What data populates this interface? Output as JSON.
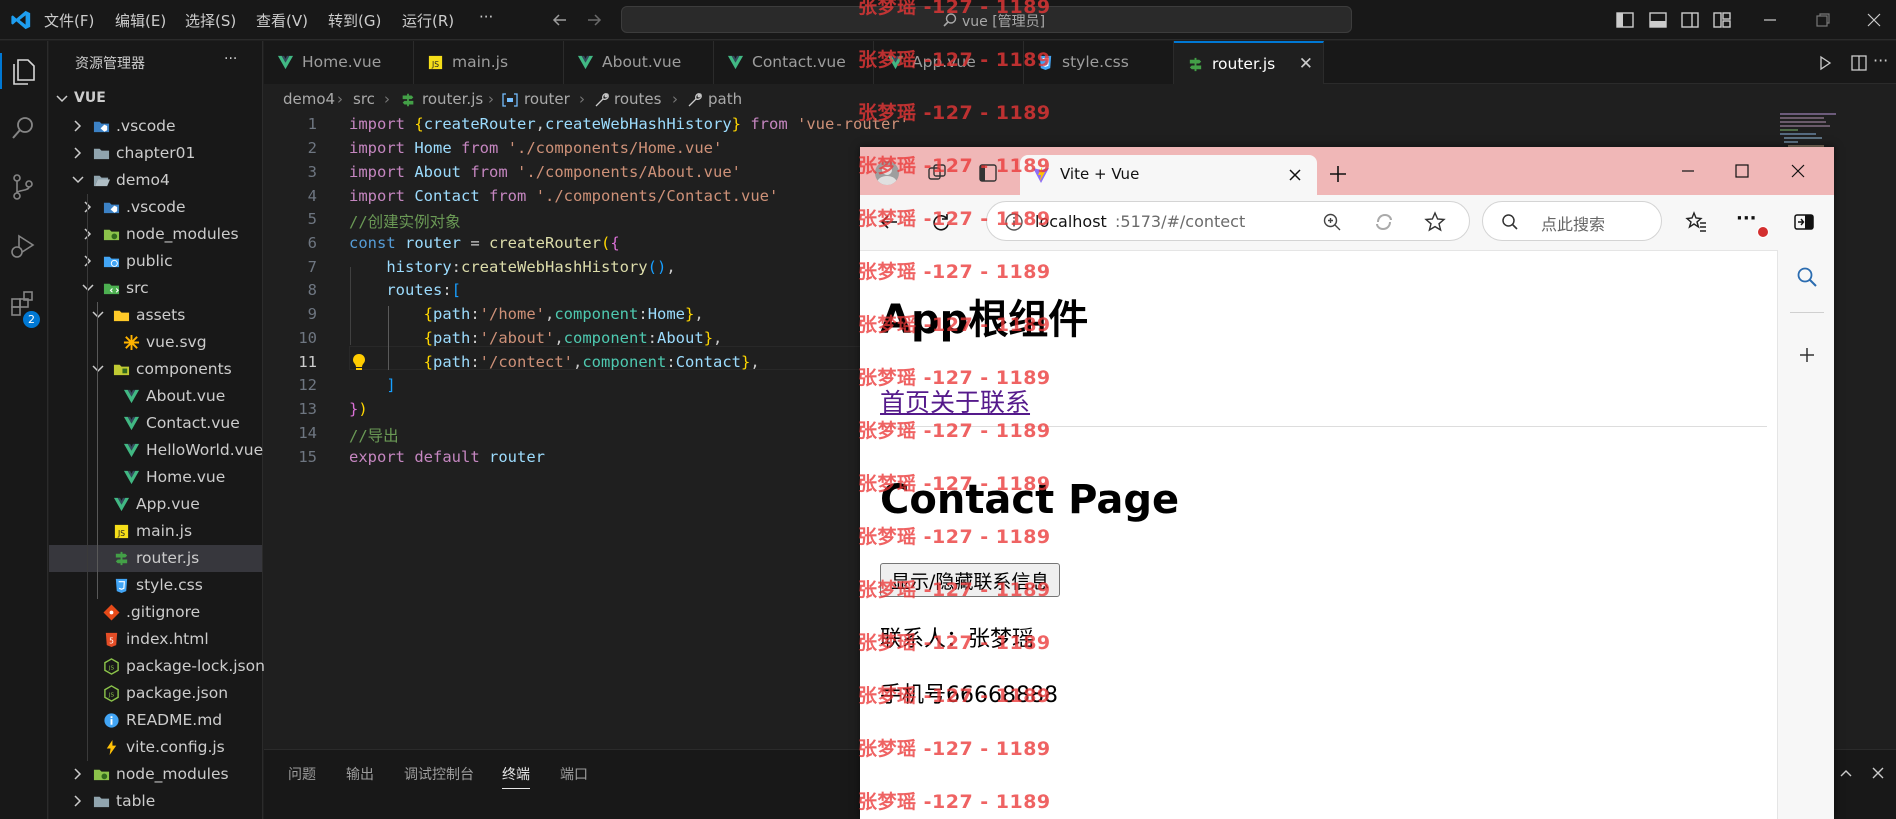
{
  "titlebar": {
    "menus": [
      "文件(F)",
      "编辑(E)",
      "选择(S)",
      "查看(V)",
      "转到(G)",
      "运行(R)",
      "···"
    ],
    "search": "vue [管理员]"
  },
  "activitybar": {
    "badge": "2"
  },
  "sidebar": {
    "title": "资源管理器",
    "more": "···",
    "root": "VUE",
    "items": [
      ".vscode",
      "chapter01",
      "demo4",
      ".vscode",
      "node_modules",
      "public",
      "src",
      "assets",
      "vue.svg",
      "components",
      "About.vue",
      "Contact.vue",
      "HelloWorld.vue",
      "Home.vue",
      "App.vue",
      "main.js",
      "router.js",
      "style.css",
      ".gitignore",
      "index.html",
      "package-lock.json",
      "package.json",
      "README.md",
      "vite.config.js",
      "node_modules",
      "table"
    ]
  },
  "tabs": [
    "Home.vue",
    "main.js",
    "About.vue",
    "Contact.vue",
    "App.vue",
    "style.css",
    "router.js"
  ],
  "breadcrumb": [
    "demo4",
    "src",
    "router.js",
    "router",
    "routes",
    "path"
  ],
  "editor": {
    "line_numbers": [
      "1",
      "2",
      "3",
      "4",
      "5",
      "6",
      "7",
      "8",
      "9",
      "10",
      "11",
      "12",
      "13",
      "14",
      "15"
    ],
    "current_line": "11"
  },
  "panel": {
    "tabs": [
      "问题",
      "输出",
      "调试控制台",
      "终端",
      "端口"
    ]
  },
  "browser": {
    "tab_title": "Vite + Vue",
    "url_host": "localhost",
    "url_rest": ":5173/#/contect",
    "search_placeholder": "点此搜索",
    "page": {
      "heading": "App根组件",
      "links": [
        "首页",
        "关于",
        "联系"
      ],
      "subheading": "Contact Page",
      "button": "显示/隐藏联系信息",
      "contact_person": "联系人：张梦瑶",
      "phone": "手机号66668888"
    }
  },
  "watermark": "张梦瑶 -127 - 1189",
  "colors": {
    "accent": "#0078d4",
    "vue_green": "#41b883",
    "browser_tabstrip": "#f0b7b7",
    "watermark": "#eb3737"
  }
}
